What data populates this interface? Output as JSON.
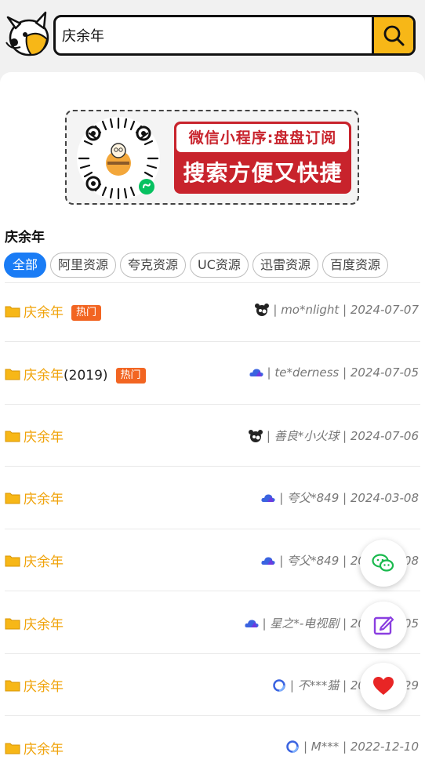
{
  "search": {
    "value": "庆余年"
  },
  "banner": {
    "top_text": "微信小程序:盘盘订阅",
    "bottom_text": "搜索方便又快捷"
  },
  "section_title": "庆余年",
  "tabs": [
    {
      "label": "全部",
      "active": true
    },
    {
      "label": "阿里资源",
      "active": false
    },
    {
      "label": "夸克资源",
      "active": false
    },
    {
      "label": "UC资源",
      "active": false
    },
    {
      "label": "迅雷资源",
      "active": false
    },
    {
      "label": "百度资源",
      "active": false
    }
  ],
  "results": [
    {
      "title": "庆余年",
      "suffix": "",
      "hot": "热门",
      "source_icon": "panda-icon",
      "meta": "| mo*nlight | 2024-07-07"
    },
    {
      "title": "庆余年",
      "suffix": "(2019)",
      "hot": "热门",
      "source_icon": "cloud-icon",
      "meta": "| te*derness | 2024-07-05"
    },
    {
      "title": "庆余年",
      "suffix": "",
      "hot": "",
      "source_icon": "panda-icon",
      "meta": "| 善良*小火球 | 2024-07-06"
    },
    {
      "title": "庆余年",
      "suffix": "",
      "hot": "",
      "source_icon": "cloud-icon",
      "meta": "| 夸父*849 | 2024-03-08"
    },
    {
      "title": "庆余年",
      "suffix": "",
      "hot": "",
      "source_icon": "cloud-icon",
      "meta": "| 夸父*849 | 2024-03-08"
    },
    {
      "title": "庆余年",
      "suffix": "",
      "hot": "",
      "source_icon": "cloud-icon",
      "meta": "| 星之*-电视剧 | 2024-03-05"
    },
    {
      "title": "庆余年",
      "suffix": "",
      "hot": "",
      "source_icon": "ring-icon",
      "meta": "| 不***猫 | 2024-01-29"
    },
    {
      "title": "庆余年",
      "suffix": "",
      "hot": "",
      "source_icon": "ring-icon",
      "meta": "| M*** | 2022-12-10"
    }
  ],
  "colors": {
    "accent": "#f7b717",
    "title": "#f0a30a",
    "tab_active": "#1a7cf5",
    "hot": "#f26522",
    "banner_red": "#c8232c"
  },
  "fabs": [
    {
      "icon": "wechat-icon"
    },
    {
      "icon": "edit-icon"
    },
    {
      "icon": "heart-icon"
    }
  ]
}
